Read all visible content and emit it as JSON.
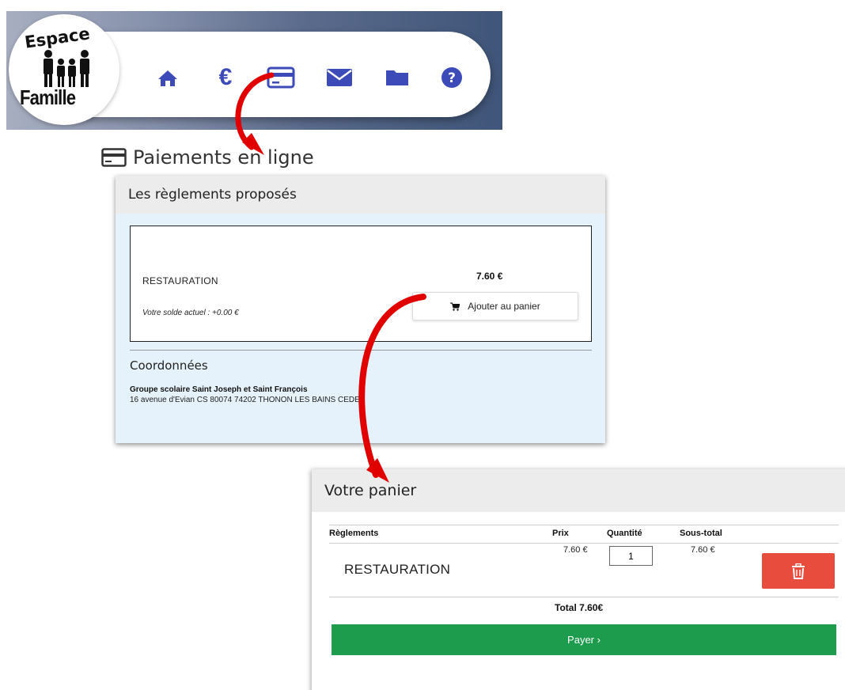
{
  "logo": {
    "top_text": "Espace",
    "bottom_text": "Famille"
  },
  "nav": {
    "icons": [
      "home-icon",
      "euro-icon",
      "credit-card-icon",
      "envelope-icon",
      "folder-icon",
      "question-icon"
    ],
    "euro_symbol": "€",
    "accent_color": "#3d4bb8"
  },
  "page_title": "Paiements en ligne",
  "offers_panel": {
    "header": "Les règlements proposés",
    "item": {
      "name": "RESTAURATION",
      "balance": "Votre solde actuel : +0.00 €",
      "price": "7.60 €",
      "add_button": "Ajouter au panier"
    },
    "contact": {
      "title": "Coordonnées",
      "name": "Groupe scolaire Saint Joseph et Saint François",
      "address": "16 avenue d'Evian CS 80074 74202 THONON LES BAINS CEDEX"
    }
  },
  "cart_panel": {
    "header": "Votre panier",
    "columns": [
      "Règlements",
      "Prix",
      "Quantité",
      "Sous-total"
    ],
    "row": {
      "name": "RESTAURATION",
      "price": "7.60 €",
      "quantity": "1",
      "subtotal": "7.60 €"
    },
    "total": "Total 7.60€",
    "pay_button": "Payer ›",
    "delete_color": "#e74c3c",
    "pay_color": "#1e9c4e"
  },
  "arrow_color": "#e00000"
}
